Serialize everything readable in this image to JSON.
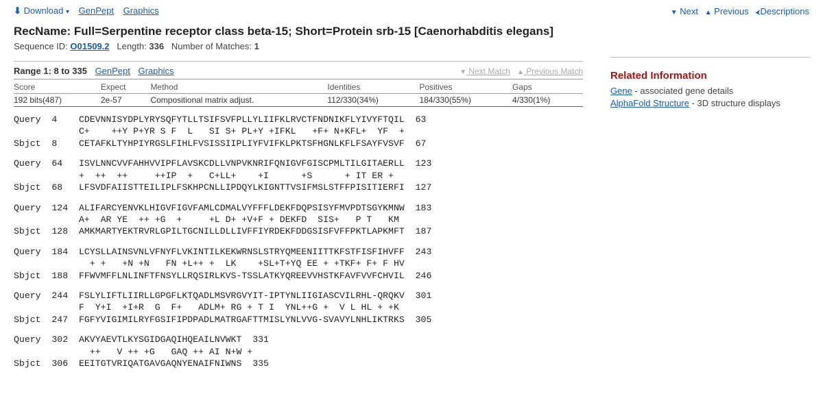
{
  "toolbar": {
    "download": "Download",
    "genpept": "GenPept",
    "graphics": "Graphics",
    "next": "Next",
    "previous": "Previous",
    "descriptions": "Descriptions"
  },
  "header": {
    "title": "RecName: Full=Serpentine receptor class beta-15; Short=Protein srb-15 [Caenorhabditis elegans]",
    "seq_id_label": "Sequence ID:",
    "seq_id": "O01509.2",
    "length_label": "Length:",
    "length": "336",
    "matches_label": "Number of Matches:",
    "matches": "1"
  },
  "range": {
    "title": "Range 1: 8 to 335",
    "genpept": "GenPept",
    "graphics": "Graphics",
    "next_match": "Next Match",
    "prev_match": "Previous Match"
  },
  "stats": {
    "headers": {
      "score": "Score",
      "expect": "Expect",
      "method": "Method",
      "identities": "Identities",
      "positives": "Positives",
      "gaps": "Gaps"
    },
    "values": {
      "score": "192 bits(487)",
      "expect": "2e-57",
      "method": "Compositional matrix adjust.",
      "identities": "112/330(34%)",
      "positives": "184/330(55%)",
      "gaps": "4/330(1%)"
    }
  },
  "alignment": [
    {
      "q": "Query  4    CDEVNNISYDPLYRYSQFYTLLTSIFSVFPLLYLIIFKLRVCTFNDNIKFLYIVYFTQIL  63",
      "m": "            C+    ++Y P+YR S F  L   SI S+ PL+Y +IFKL   +F+ N+KFL+  YF  + ",
      "s": "Sbjct  8    CETAFKLTYHPIYRGSLFIHLFVSISSIIPLIYFVIFKLPKTSFHGNLKFLFSAYFVSVF  67"
    },
    {
      "q": "Query  64   ISVLNNCVVFAHHVVIPFLAVSKCDLLVNPVKNRIFQNIGVFGISCPMLTILGITAERLL  123",
      "m": "            +  ++  ++     ++IP  +   C+LL+    +I      +S      + IT ER +  ",
      "s": "Sbjct  68   LFSVDFAIISTTEILIPLFSKHPCNLLIPDQYLKIGNTTVSIFMSLSTFFPISITIERFI  127"
    },
    {
      "q": "Query  124  ALIFARCYENVKLHIGVFIGVFAMLCDMALVYFFFLDEKFDQPSISYFMVPDTSGYKMNW  183",
      "m": "            A+  AR YE  ++ +G  +     +L D+ +V+F + DEKFD  SIS+   P T   KM  ",
      "s": "Sbjct  128  AMKMARTYEKTRVRLGPILTGCNILLDLLIVFFIYRDEKFDDGSISFVFFPKTLAPKMFT  187"
    },
    {
      "q": "Query  184  LCYSLLAINSVNLVFNYFLVKINTILKEKWRNSLSTRYQMEENIITTKFSTFISFIHVFF  243",
      "m": "              + +   +N +N   FN +L++ +  LK    +SL+T+YQ EE + +TKF+ F+ F HV  ",
      "s": "Sbjct  188  FFWVMFFLNLINFTFNSYLLRQSIRLKVS-TSSLATKYQREEVVHSTKFAVFVVFCHVIL  246"
    },
    {
      "q": "Query  244  FSLYLIFTLIIRLLGPGFLKTQADLMSVRGVYIT-IPTYNLIIGIASCVILRHL-QRQKV  301",
      "m": "            F  Y+I  +I+R  G  F+   ADLM+ RG + T I  YNL++G +  V L HL + +K  ",
      "s": "Sbjct  247  FGFYVIGIMILRYFGSIFIPDPADLMATRGAFTTMISLYNLVVG-SVAVYLNHLIKTRKS  305"
    },
    {
      "q": "Query  302  AKVYAEVTLKYSGIDGAQIHQEAILNVWKT  331",
      "m": "              ++   V ++ +G   GAQ ++ AI N+W +",
      "s": "Sbjct  306  EEITGTVRIQATGAVGAQNYENAIFNIWNS  335"
    }
  ],
  "sidebar": {
    "heading": "Related Information",
    "items": [
      {
        "link": "Gene",
        "desc": " - associated gene details"
      },
      {
        "link": "AlphaFold Structure",
        "desc": " - 3D structure displays"
      }
    ]
  }
}
